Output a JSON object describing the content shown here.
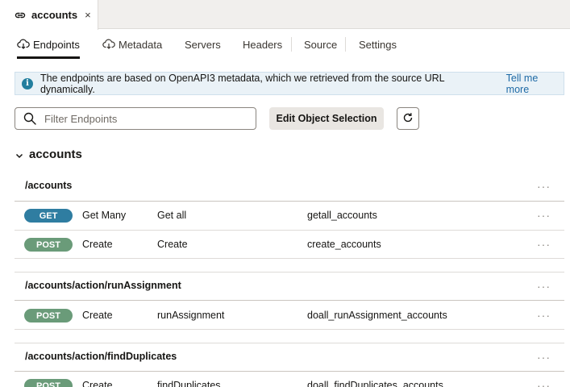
{
  "doc_tab": {
    "title": "accounts",
    "close": "×"
  },
  "tabs": [
    {
      "label": "Endpoints",
      "icon": "cloud-down-icon",
      "active": true
    },
    {
      "label": "Metadata",
      "icon": "cloud-down-icon"
    },
    {
      "label": "Servers"
    },
    {
      "label": "Headers"
    },
    {
      "label": "Source"
    },
    {
      "label": "Settings"
    }
  ],
  "banner": {
    "text": "The endpoints are based on OpenAPI3 metadata, which we retrieved from the source URL dynamically.",
    "link": "Tell me more"
  },
  "toolbar": {
    "filter_placeholder": "Filter Endpoints",
    "edit_button": "Edit Object Selection"
  },
  "group": {
    "title": "accounts"
  },
  "sections": [
    {
      "path": "/accounts",
      "rows": [
        {
          "method": "GET",
          "type": "Get Many",
          "name": "Get all",
          "id": "getall_accounts"
        },
        {
          "method": "POST",
          "type": "Create",
          "name": "Create",
          "id": "create_accounts"
        }
      ]
    },
    {
      "path": "/accounts/action/runAssignment",
      "rows": [
        {
          "method": "POST",
          "type": "Create",
          "name": "runAssignment",
          "id": "doall_runAssignment_accounts"
        }
      ]
    },
    {
      "path": "/accounts/action/findDuplicates",
      "rows": [
        {
          "method": "POST",
          "type": "Create",
          "name": "findDuplicates",
          "id": "doall_findDuplicates_accounts"
        }
      ]
    }
  ],
  "kebab": "···",
  "colors": {
    "get_badge": "#2f7da1",
    "post_badge": "#6a9b79",
    "link": "#1e6aa6",
    "info": "#227e9e"
  }
}
